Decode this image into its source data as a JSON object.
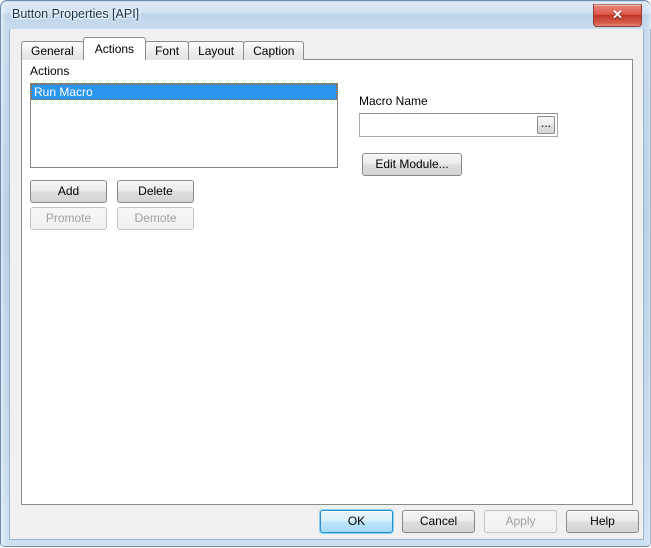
{
  "window": {
    "title": "Button Properties [API]",
    "close_glyph": "✕",
    "accent_default_button": "#2c8fcb",
    "selection_color": "#2a96f0",
    "titlebar_color": "#cfe0f1",
    "close_button_color": "#c23323",
    "dialog_face_color": "#f0f0f0"
  },
  "tabs": [
    {
      "label": "General",
      "active": false
    },
    {
      "label": "Actions",
      "active": true
    },
    {
      "label": "Font",
      "active": false
    },
    {
      "label": "Layout",
      "active": false
    },
    {
      "label": "Caption",
      "active": false
    }
  ],
  "actions_panel": {
    "list_label": "Actions",
    "items": [
      {
        "label": "Run Macro",
        "selected": true
      }
    ],
    "buttons": {
      "add": {
        "label": "Add",
        "enabled": true
      },
      "delete": {
        "label": "Delete",
        "enabled": true
      },
      "promote": {
        "label": "Promote",
        "enabled": false
      },
      "demote": {
        "label": "Demote",
        "enabled": false
      }
    }
  },
  "macro_panel": {
    "name_label": "Macro Name",
    "name_value": "",
    "name_placeholder": "",
    "browse_label": "...",
    "edit_module_label": "Edit Module..."
  },
  "footer": {
    "ok": {
      "label": "OK",
      "enabled": true,
      "default": true
    },
    "cancel": {
      "label": "Cancel",
      "enabled": true
    },
    "apply": {
      "label": "Apply",
      "enabled": false
    },
    "help": {
      "label": "Help",
      "enabled": true
    }
  }
}
